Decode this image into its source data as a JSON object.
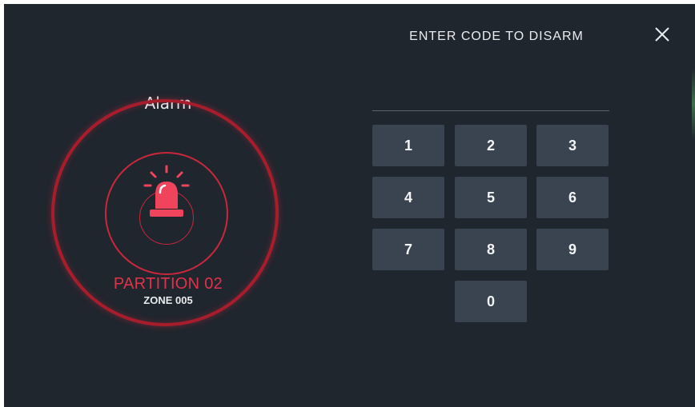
{
  "alarm": {
    "title": "Alarm",
    "partition": "PARTITION 02",
    "zone": "ZONE 005",
    "icon": "siren-icon",
    "accent_color": "#e0334a"
  },
  "keypad": {
    "title": "ENTER CODE TO DISARM",
    "code_value": "",
    "keys": [
      "1",
      "2",
      "3",
      "4",
      "5",
      "6",
      "7",
      "8",
      "9",
      "0"
    ],
    "close_icon": "close-icon"
  }
}
